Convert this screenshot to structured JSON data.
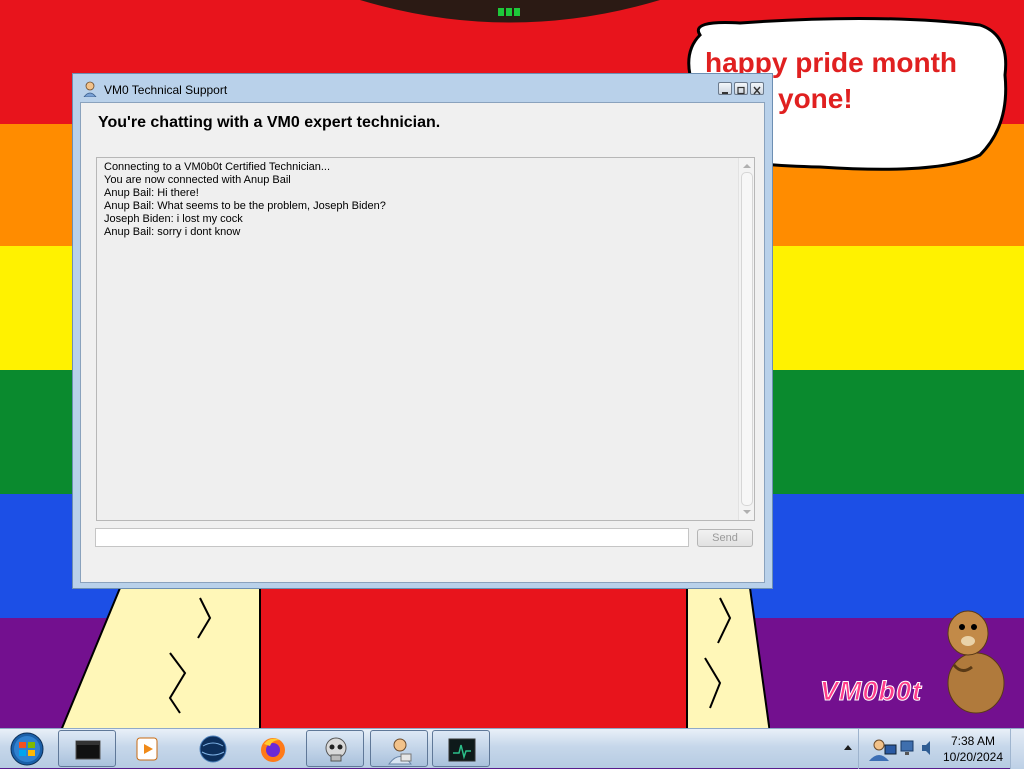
{
  "desktop": {
    "speech_bubble": {
      "line1": "happy pride month",
      "line2": "yone!"
    },
    "brand_text": "VM0b0t",
    "colors": {
      "red": "#e8141c",
      "orange": "#ff8c00",
      "yellow": "#fff200",
      "green": "#0a8a2e",
      "blue": "#1c4fe6",
      "purple": "#73108f"
    }
  },
  "window": {
    "title": "VM0 Technical Support",
    "header": "You're chatting with a VM0 expert technician.",
    "chat_log": [
      "Connecting to a VM0b0t Certified Technician...",
      "You are now connected with Anup Bail",
      "Anup Bail: Hi there!",
      "Anup Bail: What seems to be the problem, Joseph Biden?",
      "Joseph Biden: i lost my cock",
      "Anup Bail: sorry i dont know"
    ],
    "message_value": "",
    "send_label": "Send"
  },
  "taskbar": {
    "items": [
      {
        "name": "terminal-icon"
      },
      {
        "name": "media-player-icon"
      },
      {
        "name": "globe-icon"
      },
      {
        "name": "firefox-icon"
      },
      {
        "name": "skull-app-icon"
      },
      {
        "name": "tech-support-icon",
        "active": true
      },
      {
        "name": "monitor-app-icon",
        "active": true
      }
    ],
    "clock": {
      "time": "7:38 AM",
      "date": "10/20/2024"
    }
  }
}
